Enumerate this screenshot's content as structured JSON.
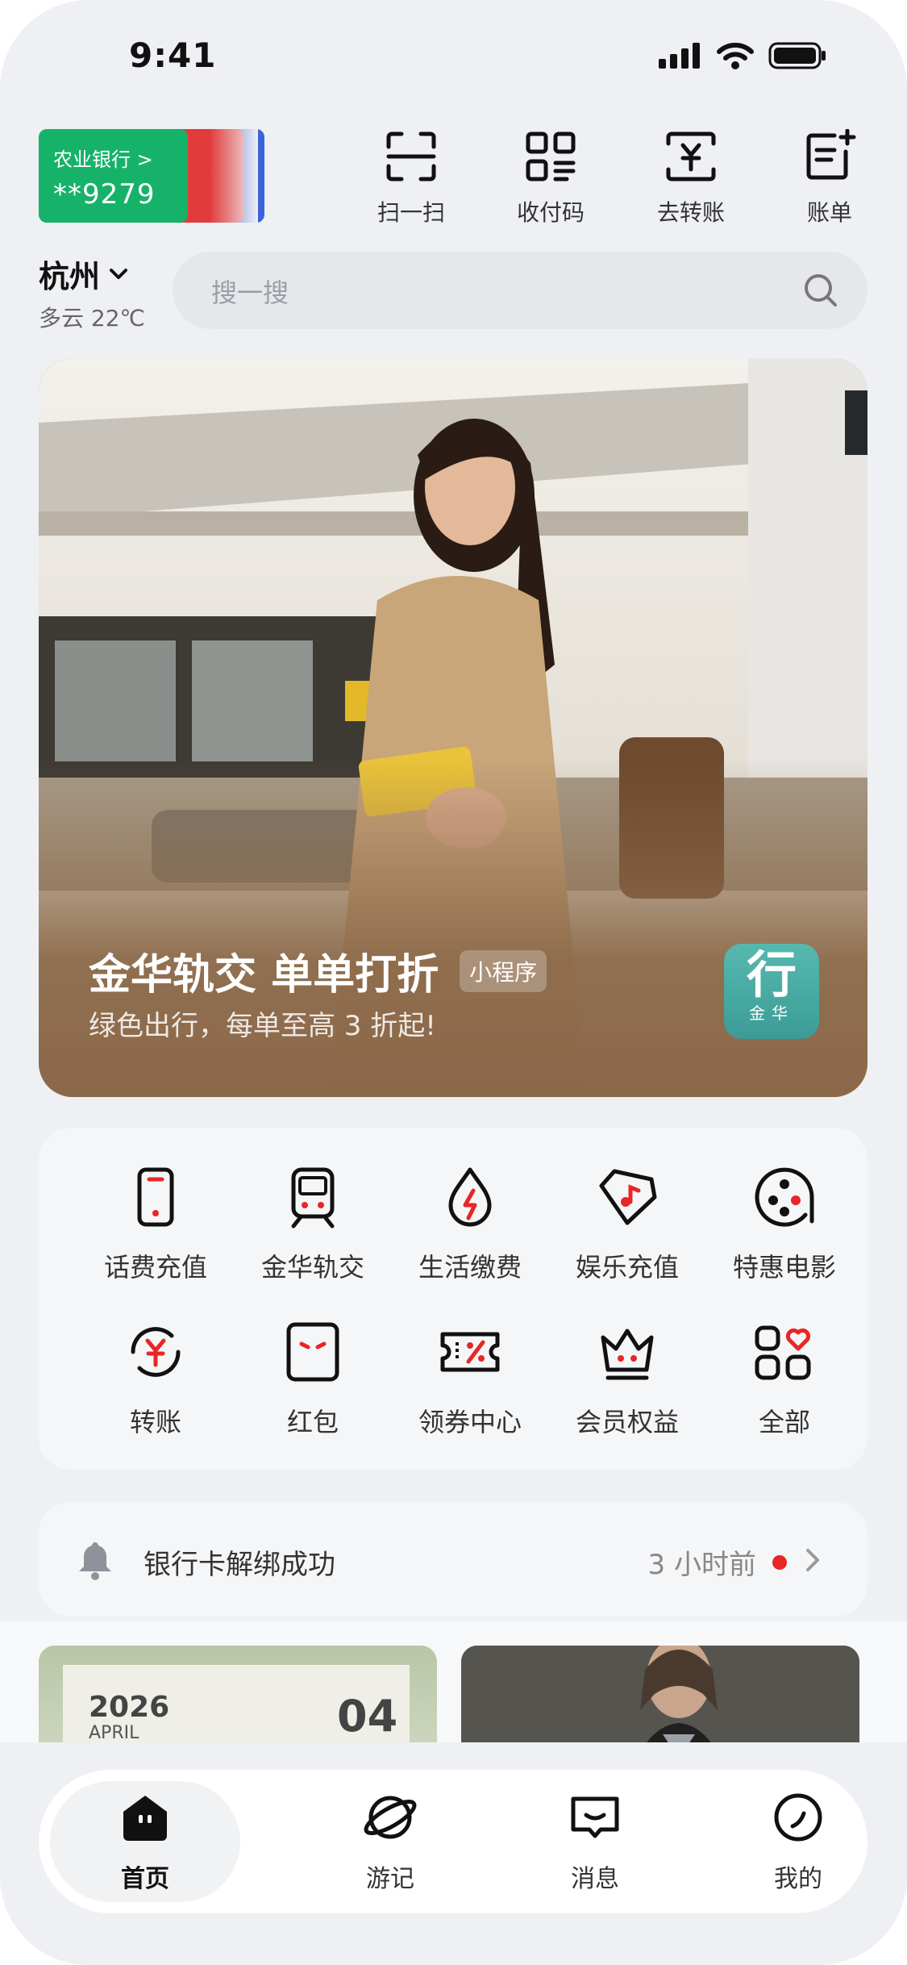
{
  "status_bar": {
    "time": "9:41"
  },
  "bank_card": {
    "bank_name": "农业银行 >",
    "card_number": "**9279"
  },
  "quick_actions": [
    {
      "label": "扫一扫",
      "icon": "scan-icon"
    },
    {
      "label": "收付码",
      "icon": "qr-code-icon"
    },
    {
      "label": "去转账",
      "icon": "transfer-icon"
    },
    {
      "label": "账单",
      "icon": "bill-icon"
    }
  ],
  "location": {
    "city": "杭州",
    "weather": "多云 22℃"
  },
  "search": {
    "placeholder": "搜一搜"
  },
  "banner": {
    "title": "金华轨交 单单打折",
    "tag": "小程序",
    "subtitle": "绿色出行，每单至高 3 折起!",
    "mini_app_char": "行",
    "mini_app_name": "金华"
  },
  "services": [
    {
      "label": "话费充值",
      "icon": "phone-icon"
    },
    {
      "label": "金华轨交",
      "icon": "train-icon"
    },
    {
      "label": "生活缴费",
      "icon": "utility-drop-icon"
    },
    {
      "label": "娱乐充值",
      "icon": "music-tag-icon"
    },
    {
      "label": "特惠电影",
      "icon": "film-reel-icon"
    },
    {
      "label": "转账",
      "icon": "transfer-cycle-icon"
    },
    {
      "label": "红包",
      "icon": "red-packet-icon"
    },
    {
      "label": "领券中心",
      "icon": "coupon-icon"
    },
    {
      "label": "会员权益",
      "icon": "crown-icon"
    },
    {
      "label": "全部",
      "icon": "all-apps-icon"
    }
  ],
  "notification": {
    "text": "银行卡解绑成功",
    "time": "3 小时前"
  },
  "feed": {
    "card1_year": "2026",
    "card1_month": "APRIL",
    "card1_day": "04"
  },
  "tab_bar": [
    {
      "label": "首页",
      "icon": "home-icon",
      "active": true
    },
    {
      "label": "游记",
      "icon": "planet-icon",
      "active": false
    },
    {
      "label": "消息",
      "icon": "message-icon",
      "active": false
    },
    {
      "label": "我的",
      "icon": "profile-icon",
      "active": false
    }
  ],
  "colors": {
    "accent_red": "#e82626",
    "card_green": "#17b26a",
    "banner_brown": "#8b6849"
  }
}
